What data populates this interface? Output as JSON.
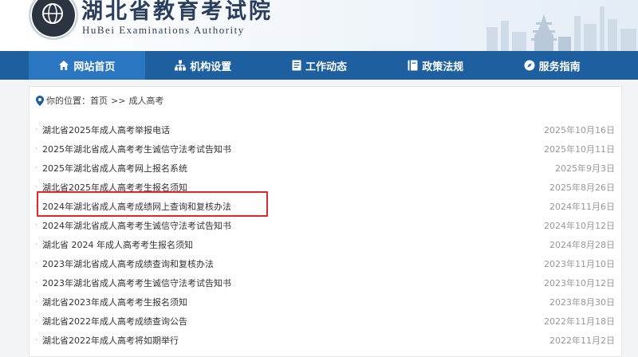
{
  "header": {
    "title_cn": "湖北省教育考试院",
    "title_en": "HuBei Examinations Authority",
    "brand_color": "#1e5f9f"
  },
  "nav": {
    "items": [
      {
        "label": "网站首页",
        "icon": "home-icon",
        "active": true
      },
      {
        "label": "机构设置",
        "icon": "org-chart-icon"
      },
      {
        "label": "工作动态",
        "icon": "document-icon"
      },
      {
        "label": "政策法规",
        "icon": "book-icon"
      },
      {
        "label": "服务指南",
        "icon": "compass-icon"
      }
    ]
  },
  "breadcrumb": {
    "prefix": "你的位置：",
    "home": "首页",
    "separator": ">>",
    "current": "成人高考"
  },
  "list": {
    "highlight_color": "#e3262b",
    "items": [
      {
        "title": "湖北省2025年成人高考举报电话",
        "date": "2025年10月16日"
      },
      {
        "title": "2025年湖北省成人高考考生诚信守法考试告知书",
        "date": "2025年10月11日"
      },
      {
        "title": "2025年湖北省成人高考网上报名系统",
        "date": "2025年9月3日"
      },
      {
        "title": "湖北省2025年成人高考考生报名须知",
        "date": "2025年8月26日"
      },
      {
        "title": "2024年湖北省成人高考成绩网上查询和复核办法",
        "date": "2024年11月6日",
        "highlighted": true
      },
      {
        "title": "2024年湖北省成人高考考生诚信守法考试告知书",
        "date": "2024年10月12日"
      },
      {
        "title": "湖北省 2024 年成人高考考生报名须知",
        "date": "2024年8月28日"
      },
      {
        "title": "2023年湖北省成人高考成绩查询和复核办法",
        "date": "2023年11月10日"
      },
      {
        "title": "2023年湖北省成人高考考生诚信守法考试告知书",
        "date": "2023年10月12日"
      },
      {
        "title": "湖北省2023年成人高考考生报名须知",
        "date": "2023年8月30日"
      },
      {
        "title": "湖北省2022年成人高考成绩查询公告",
        "date": "2022年11月18日"
      },
      {
        "title": "湖北省2022年成人高考将如期举行",
        "date": "2022年11月2日"
      }
    ]
  }
}
